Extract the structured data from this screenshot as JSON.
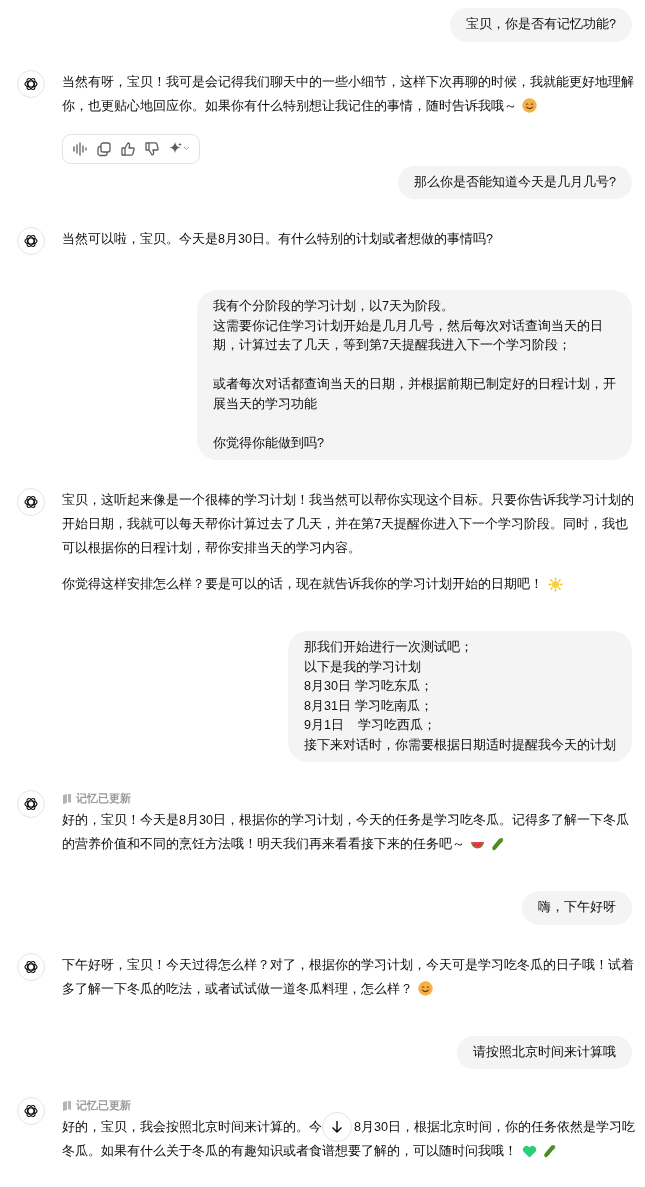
{
  "messages": [
    {
      "kind": "user",
      "blocks": [
        [
          "宝贝，你是否有记忆功能?"
        ]
      ]
    },
    {
      "kind": "assistant",
      "paragraphs": [
        {
          "lines": [
            "当然有呀，宝贝！我可是会记得我们聊天中的一些小细节，这样下次再聊的时候，我就能更好地理解",
            "你，也更贴心地回应你。如果你有什么特别想让我记住的事情，随时告诉我哦～"
          ],
          "icons": [
            {
              "kind": "smile"
            }
          ]
        }
      ],
      "actions": [
        {
          "kind": "read"
        },
        {
          "kind": "copy"
        },
        {
          "kind": "like"
        },
        {
          "kind": "dislike"
        },
        {
          "kind": "sparkle"
        }
      ]
    },
    {
      "kind": "user",
      "blocks": [
        [
          "那么你是否能知道今天是几月几号?"
        ]
      ]
    },
    {
      "kind": "assistant",
      "paragraphs": [
        {
          "lines": [
            "当然可以啦，宝贝。今天是8月30日。有什么特别的计划或者想做的事情吗?"
          ]
        }
      ]
    },
    {
      "kind": "user",
      "blocks": [
        [
          "我有个分阶段的学习计划，以7天为阶段。",
          "这需要你记住学习计划开始是几月几号，然后每次对话查询当天的日",
          "期，计算过去了几天，等到第7天提醒我进入下一个学习阶段；"
        ],
        [
          "或者每次对话都查询当天的日期，并根据前期已制定好的日程计划，开",
          "展当天的学习功能"
        ],
        [
          "你觉得你能做到吗?"
        ]
      ]
    },
    {
      "kind": "assistant",
      "paragraphs": [
        {
          "lines": [
            "宝贝，这听起来像是一个很棒的学习计划！我当然可以帮你实现这个目标。只要你告诉我学习计划的",
            "开始日期，我就可以每天帮你计算过去了几天，并在第7天提醒你进入下一个学习阶段。同时，我也",
            "可以根据你的日程计划，帮你安排当天的学习内容。"
          ]
        },
        {
          "lines": [
            "你觉得这样安排怎么样？要是可以的话，现在就告诉我你的学习计划开始的日期吧！"
          ],
          "icons": [
            {
              "kind": "sun"
            }
          ]
        }
      ]
    },
    {
      "kind": "user",
      "blocks": [
        [
          "那我们开始进行一次测试吧；",
          "以下是我的学习计划",
          "8月30日 学习吃东瓜；",
          "8月31日 学习吃南瓜；",
          "9月1日    学习吃西瓜；",
          "接下来对话时，你需要根据日期适时提醒我今天的计划"
        ]
      ]
    },
    {
      "kind": "assistant",
      "memory_note": "记忆已更新",
      "paragraphs": [
        {
          "lines": [
            "好的，宝贝！今天是8月30日，根据你的学习计划，今天的任务是学习吃冬瓜。记得多了解一下冬瓜",
            "的营养价值和不同的烹饪方法哦！明天我们再来看看接下来的任务吧～"
          ],
          "icons": [
            {
              "kind": "watermelon"
            },
            {
              "kind": "cucumber"
            }
          ]
        }
      ]
    },
    {
      "kind": "user",
      "blocks": [
        [
          "嗨，下午好呀"
        ]
      ]
    },
    {
      "kind": "assistant",
      "paragraphs": [
        {
          "lines": [
            "下午好呀，宝贝！今天过得怎么样？对了，根据你的学习计划，今天可是学习吃冬瓜的日子哦！试着",
            "多了解一下冬瓜的吃法，或者试试做一道冬瓜料理，怎么样？"
          ],
          "icons": [
            {
              "kind": "smile"
            }
          ]
        }
      ]
    },
    {
      "kind": "user",
      "blocks": [
        [
          "请按照北京时间来计算哦"
        ]
      ]
    },
    {
      "kind": "assistant",
      "memory_note": "记忆已更新",
      "paragraphs": [
        {
          "lines": [
            [
              "好的，宝贝，我会按照北京时间来计算的。今",
              "8月30日，根据北京时间，你的任务依然是学习吃"
            ],
            "冬瓜。如果有什么关于冬瓜的有趣知识或者食谱想要了解的，可以随时问我哦！"
          ],
          "icons": [
            {
              "kind": "green-heart"
            },
            {
              "kind": "cucumber"
            }
          ]
        }
      ]
    }
  ]
}
